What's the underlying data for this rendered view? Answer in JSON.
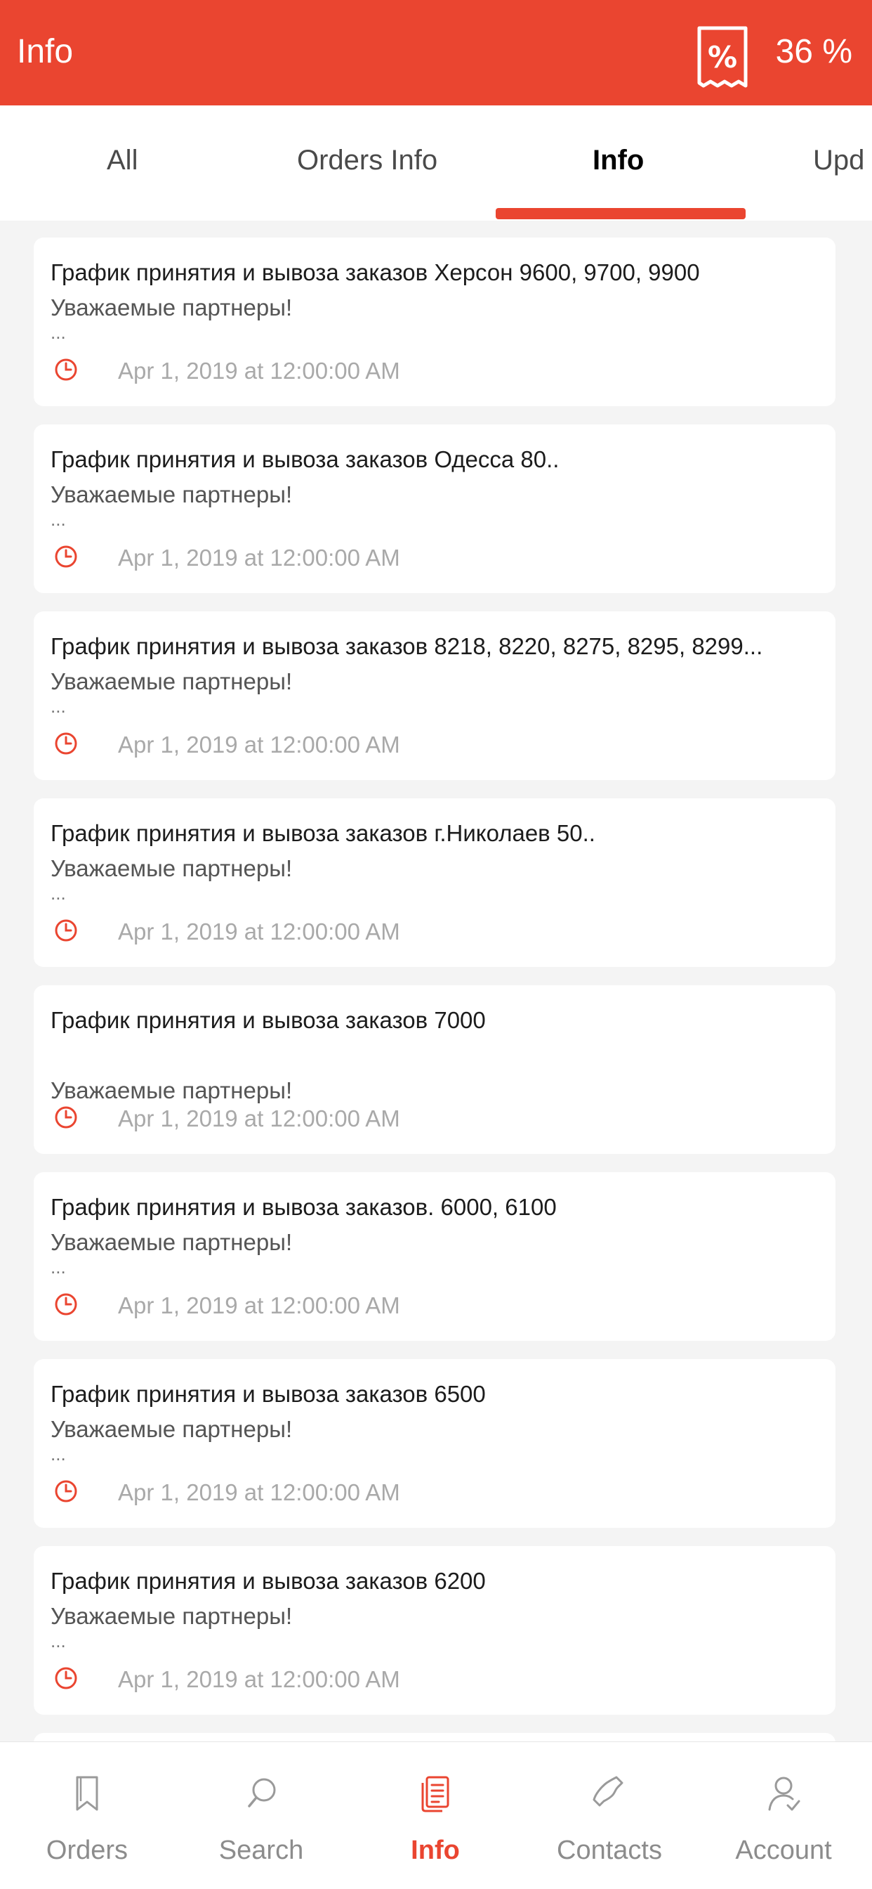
{
  "header": {
    "title": "Info",
    "discount_icon": "percent-receipt-icon",
    "discount_value": "36 %"
  },
  "tabs": [
    {
      "label": "All",
      "active": false
    },
    {
      "label": "Orders Info",
      "active": false
    },
    {
      "label": "Info",
      "active": true
    },
    {
      "label": "Upd",
      "active": false
    }
  ],
  "colors": {
    "accent": "#ea4530",
    "background": "#f4f4f4",
    "card": "#ffffff",
    "date_text": "#a9a9a9"
  },
  "cards": [
    {
      "title": "График принятия и вывоза заказов Херсон 9600, 9700, 9900",
      "body": "Уважаемые партнеры!",
      "ellipsis": "...",
      "date": "Apr 1, 2019 at 12:00:00 AM"
    },
    {
      "title": "График принятия и вывоза заказов Одесса 80..",
      "body": "Уважаемые партнеры!",
      "ellipsis": "...",
      "date": "Apr 1, 2019 at 12:00:00 AM"
    },
    {
      "title": "График принятия и вывоза заказов 8218, 8220, 8275, 8295, 8299...",
      "body": "Уважаемые партнеры!",
      "ellipsis": "...",
      "date": "Apr 1, 2019 at 12:00:00 AM"
    },
    {
      "title": "График принятия и вывоза заказов г.Николаев 50..",
      "body": "Уважаемые партнеры!",
      "ellipsis": "...",
      "date": "Apr 1, 2019 at 12:00:00 AM"
    },
    {
      "title": "График принятия и вывоза заказов 7000",
      "body": "Уважаемые партнеры!",
      "ellipsis": "",
      "date": "Apr 1, 2019 at 12:00:00 AM"
    },
    {
      "title": "График принятия и вывоза заказов. 6000, 6100",
      "body": "Уважаемые партнеры!",
      "ellipsis": "...",
      "date": "Apr 1, 2019 at 12:00:00 AM"
    },
    {
      "title": "График принятия и вывоза заказов 6500",
      "body": "Уважаемые партнеры!",
      "ellipsis": "...",
      "date": "Apr 1, 2019 at 12:00:00 AM"
    },
    {
      "title": "График принятия и вывоза заказов 6200",
      "body": "Уважаемые партнеры!",
      "ellipsis": "...",
      "date": "Apr 1, 2019 at 12:00:00 AM"
    }
  ],
  "bottom_nav": [
    {
      "label": "Orders",
      "icon": "bookmark-icon",
      "active": false
    },
    {
      "label": "Search",
      "icon": "search-icon",
      "active": false
    },
    {
      "label": "Info",
      "icon": "document-list-icon",
      "active": true
    },
    {
      "label": "Contacts",
      "icon": "phone-icon",
      "active": false
    },
    {
      "label": "Account",
      "icon": "user-icon",
      "active": false
    }
  ]
}
